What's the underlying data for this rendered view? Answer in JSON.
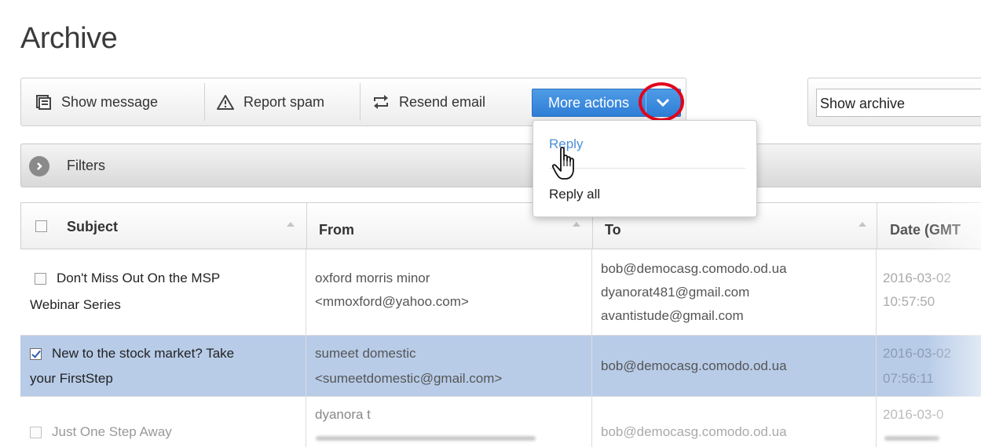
{
  "page_title": "Archive",
  "toolbar": {
    "show_message": "Show message",
    "report_spam": "Report spam",
    "resend_email": "Resend email",
    "more_actions": "More actions"
  },
  "archive_select": {
    "value": "Show archive"
  },
  "filters": {
    "label": "Filters"
  },
  "dropdown": {
    "items": [
      "Reply",
      "Reply all"
    ]
  },
  "table": {
    "columns": [
      "Subject",
      "From",
      "To",
      "Date (GMT"
    ],
    "rows": [
      {
        "checked": false,
        "subject_line1": "Don't Miss Out On the MSP",
        "subject_line2": "Webinar Series",
        "from_name": "oxford morris minor",
        "from_email": "<mmoxford@yahoo.com>",
        "to": [
          "bob@democasg.comodo.od.ua",
          "dyanorat481@gmail.com",
          "avantistude@gmail.com"
        ],
        "date": "2016-03-02",
        "time": "10:57:50"
      },
      {
        "checked": true,
        "subject_line1": "New to the stock market? Take",
        "subject_line2": "your FirstStep",
        "from_name": "sumeet domestic",
        "from_email": "<sumeetdomestic@gmail.com>",
        "to": [
          "bob@democasg.comodo.od.ua"
        ],
        "date": "2016-03-02",
        "time": "07:56:11"
      },
      {
        "checked": false,
        "subject_line1": "Just One Step Away",
        "from_name": "dyanora t",
        "to": [
          "bob@democasg.comodo.od.ua"
        ],
        "date": "2016-03-0"
      }
    ]
  },
  "colors": {
    "accent": "#2e7ed6",
    "selected_row": "#b8cce8",
    "highlight_ring": "#e3001b",
    "link": "#4a8fd6"
  },
  "icons": [
    "message-icon",
    "warning-icon",
    "resend-icon",
    "chevron-down-icon",
    "chevron-right-icon",
    "hand-cursor-icon"
  ]
}
